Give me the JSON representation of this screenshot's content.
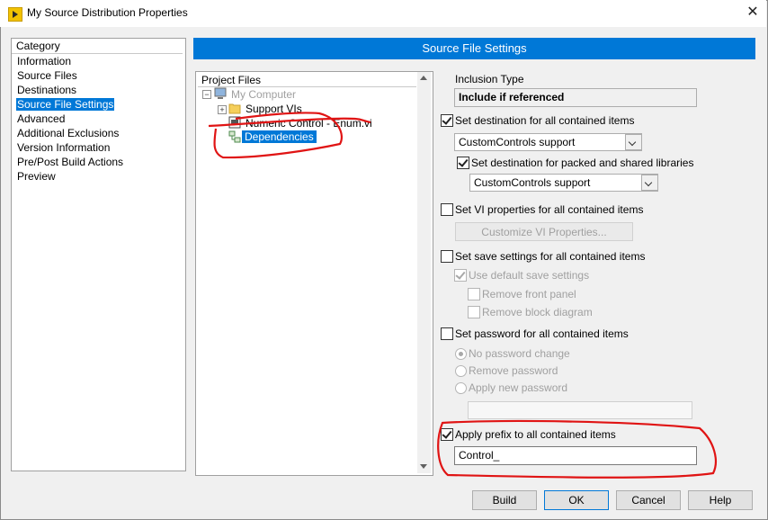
{
  "window": {
    "title": "My Source Distribution Properties",
    "close_glyph": "✕"
  },
  "category": {
    "header": "Category",
    "items": [
      {
        "label": "Information"
      },
      {
        "label": "Source Files"
      },
      {
        "label": "Destinations"
      },
      {
        "label": "Source File Settings",
        "selected": true
      },
      {
        "label": "Advanced"
      },
      {
        "label": "Additional Exclusions"
      },
      {
        "label": "Version Information"
      },
      {
        "label": "Pre/Post Build Actions"
      },
      {
        "label": "Preview"
      }
    ]
  },
  "section_title": "Source File Settings",
  "project_files": {
    "header": "Project Files",
    "tree": {
      "root": "My Computer",
      "children": [
        "Support VIs",
        "Numeric Control - Enum.vi",
        "Dependencies"
      ]
    }
  },
  "settings": {
    "inclusion_type_label": "Inclusion Type",
    "inclusion_type_value": "Include if referenced",
    "set_destination": {
      "label": "Set destination for all contained items",
      "checked": true,
      "value": "CustomControls support"
    },
    "set_destination_packed": {
      "label": "Set destination for packed and shared libraries",
      "checked": true,
      "value": "CustomControls support"
    },
    "set_vi_props": {
      "label": "Set VI properties for all contained items",
      "checked": false,
      "button": "Customize VI Properties..."
    },
    "set_save": {
      "label": "Set save settings for all contained items",
      "checked": false
    },
    "use_default_save": {
      "label": "Use default save settings",
      "checked": true
    },
    "remove_front_panel": {
      "label": "Remove front panel",
      "checked": false
    },
    "remove_block_diagram": {
      "label": "Remove block diagram",
      "checked": false
    },
    "set_password": {
      "label": "Set password for all contained items",
      "checked": false
    },
    "pw_options": [
      "No password change",
      "Remove password",
      "Apply new password"
    ],
    "password_value": "",
    "apply_prefix": {
      "label": "Apply prefix to all contained items",
      "checked": true,
      "value": "Control_"
    }
  },
  "buttons": {
    "build": "Build",
    "ok": "OK",
    "cancel": "Cancel",
    "help": "Help"
  },
  "colors": {
    "accent": "#0078d7",
    "annotation": "#e01414"
  }
}
